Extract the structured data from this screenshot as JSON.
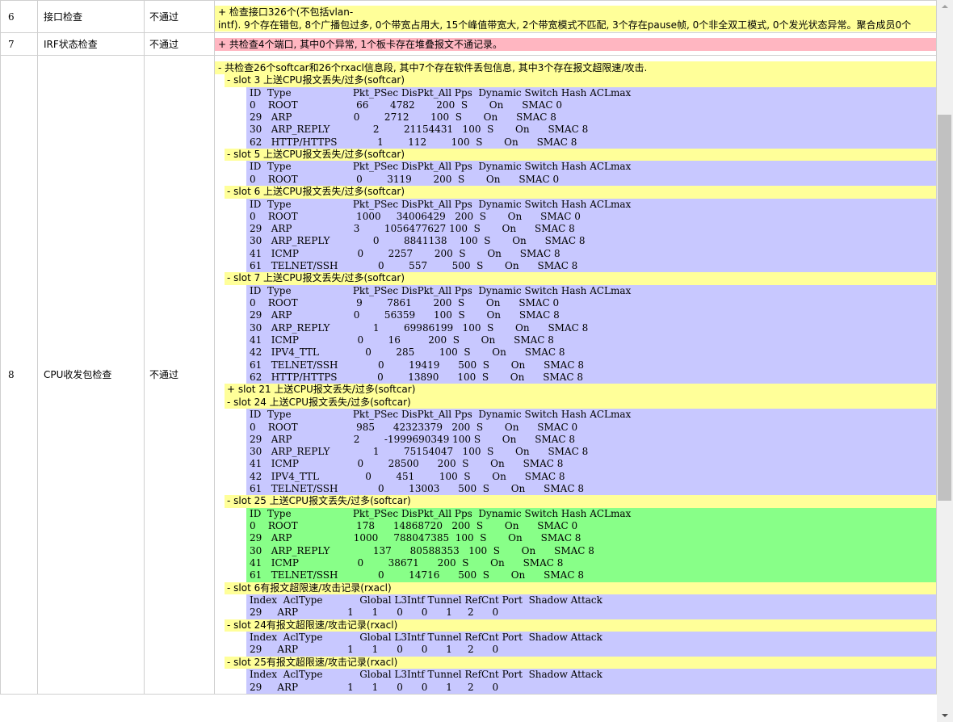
{
  "rows": [
    {
      "no": "6",
      "name": "接口检查",
      "result": "不通过",
      "detail_lines": [
        "+ 检查接口326个(不包括vlan-",
        "intf). 9个存在错包, 8个广播包过多, 0个带宽占用大, 15个峰值带宽大, 2个带宽模式不匹配, 3个存在pause帧, 0个非全双工模式, 0个发光状态异常。聚合成员0个"
      ]
    },
    {
      "no": "7",
      "name": "IRF状态检查",
      "result": "不通过",
      "detail": "+ 共检查4个端口, 其中0个异常, 1个板卡存在堆叠报文不通记录。"
    },
    {
      "no": "8",
      "name": "CPU收发包检查",
      "result": "不通过",
      "summary": "- 共检查26个softcar和26个rxacl信息段, 其中7个存在软件丢包信息, 其中3个存在报文超限速/攻击.",
      "sections": [
        {
          "title": "- slot 3 上送CPU报文丢失/过多(softcar)",
          "color": "purple",
          "lines": [
            "ID  Type                    Pkt_PSec DisPkt_All Pps  Dynamic Switch Hash ACLmax",
            "0    ROOT                   66       4782       200  S       On      SMAC 0",
            "29   ARP                    0        2712       100  S       On      SMAC 8",
            "30   ARP_REPLY              2        21154431   100  S       On      SMAC 8",
            "62   HTTP/HTTPS             1        112        100  S       On      SMAC 8"
          ]
        },
        {
          "title": "- slot 5 上送CPU报文丢失/过多(softcar)",
          "color": "purple",
          "lines": [
            "ID  Type                    Pkt_PSec DisPkt_All Pps  Dynamic Switch Hash ACLmax",
            "0    ROOT                   0        3119       200  S       On      SMAC 0"
          ]
        },
        {
          "title": "- slot 6 上送CPU报文丢失/过多(softcar)",
          "color": "purple",
          "lines": [
            "ID  Type                    Pkt_PSec DisPkt_All Pps  Dynamic Switch Hash ACLmax",
            "0    ROOT                   1000     34006429   200  S       On      SMAC 0",
            "29   ARP                    3        1056477627 100  S       On      SMAC 8",
            "30   ARP_REPLY              0        8841138    100  S       On      SMAC 8",
            "41   ICMP                   0        2257       200  S       On      SMAC 8",
            "61   TELNET/SSH             0        557        500  S       On      SMAC 8"
          ]
        },
        {
          "title": "- slot 7 上送CPU报文丢失/过多(softcar)",
          "color": "purple",
          "lines": [
            "ID  Type                    Pkt_PSec DisPkt_All Pps  Dynamic Switch Hash ACLmax",
            "0    ROOT                   9        7861       200  S       On      SMAC 0",
            "29   ARP                    0        56359      100  S       On      SMAC 8",
            "30   ARP_REPLY              1        69986199   100  S       On      SMAC 8",
            "41   ICMP                   0        16         200  S       On      SMAC 8",
            "42   IPV4_TTL               0        285        100  S       On      SMAC 8",
            "61   TELNET/SSH             0        19419      500  S       On      SMAC 8",
            "62   HTTP/HTTPS             0        13890      100  S       On      SMAC 8"
          ]
        },
        {
          "title": "+ slot 21 上送CPU报文丢失/过多(softcar)",
          "color": "none",
          "lines": []
        },
        {
          "title": "- slot 24 上送CPU报文丢失/过多(softcar)",
          "color": "purple",
          "lines": [
            "ID  Type                    Pkt_PSec DisPkt_All Pps  Dynamic Switch Hash ACLmax",
            "0    ROOT                   985      42323379   200  S       On      SMAC 0",
            "29   ARP                    2        -1999690349 100 S       On      SMAC 8",
            "30   ARP_REPLY              1        75154047   100  S       On      SMAC 8",
            "41   ICMP                   0        28500      200  S       On      SMAC 8",
            "42   IPV4_TTL               0        451        100  S       On      SMAC 8",
            "61   TELNET/SSH             0        13003      500  S       On      SMAC 8"
          ]
        },
        {
          "title": "- slot 25 上送CPU报文丢失/过多(softcar)",
          "color": "green",
          "lines": [
            "ID  Type                    Pkt_PSec DisPkt_All Pps  Dynamic Switch Hash ACLmax",
            "0    ROOT                   178      14868720   200  S       On      SMAC 0",
            "29   ARP                    1000     788047385  100  S       On      SMAC 8",
            "30   ARP_REPLY              137      80588353   100  S       On      SMAC 8",
            "41   ICMP                   0        38671      200  S       On      SMAC 8",
            "61   TELNET/SSH             0        14716      500  S       On      SMAC 8"
          ]
        },
        {
          "title": "- slot 6有报文超限速/攻击记录(rxacl)",
          "color": "purple",
          "lines": [
            "Index  AclType            Global L3Intf Tunnel RefCnt Port  Shadow Attack",
            "29     ARP                1      1      0      0      1     2      0"
          ]
        },
        {
          "title": "- slot 24有报文超限速/攻击记录(rxacl)",
          "color": "purple",
          "lines": [
            "Index  AclType            Global L3Intf Tunnel RefCnt Port  Shadow Attack",
            "29     ARP                1      1      0      0      1     2      0"
          ]
        },
        {
          "title": "- slot 25有报文超限速/攻击记录(rxacl)",
          "color": "purple",
          "lines": [
            "Index  AclType            Global L3Intf Tunnel RefCnt Port  Shadow Attack",
            "29     ARP                1      1      0      0      1     2      0"
          ]
        }
      ]
    }
  ]
}
